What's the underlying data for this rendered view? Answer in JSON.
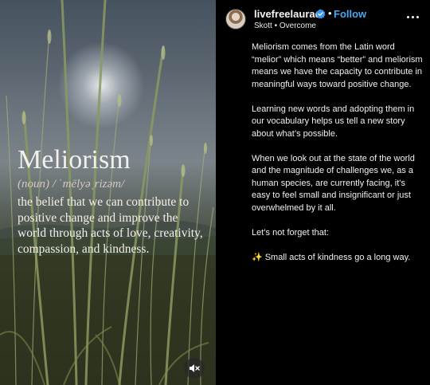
{
  "media": {
    "word": "Meliorism",
    "pronunciation": "(noun) / ˈmēlyəˌrizəm/",
    "definition": "the belief that we can contribute to positive change and improve the world through acts of love, creativity, compassion, and kindness.",
    "mute_icon": "speaker-muted-icon"
  },
  "header": {
    "username": "livefreelaurad",
    "verified_icon": "verified-badge-icon",
    "separator": "•",
    "follow_label": "Follow",
    "audio_artist": "Skott",
    "audio_sep": "•",
    "audio_title": "Overcome",
    "more_icon": "more-options-icon"
  },
  "caption": {
    "paragraphs": [
      "Meliorism comes from the Latin word “melior” which means “better” and meliorism means we have the capacity to contribute in meaningful ways toward positive change.",
      "Learning new words and adopting them in our vocabulary helps us tell a new story about what’s possible.",
      "When we look out at the state of the world and the magnitude of challenges we, as a human species, are currently facing, it’s easy to feel small and insignificant or just overwhelmed by it all.",
      "Let’s not forget that:"
    ],
    "sparkle": "✨",
    "closing": "Small acts of kindness go a long way."
  },
  "colors": {
    "background": "#000000",
    "follow": "#4aa8f3",
    "verified": "#3b96f0"
  }
}
